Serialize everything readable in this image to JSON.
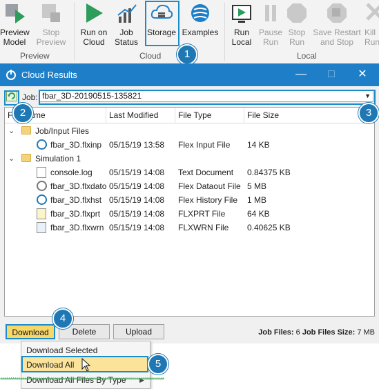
{
  "ribbon": {
    "groups": [
      {
        "label": "Preview"
      },
      {
        "label": "Cloud"
      },
      {
        "label": "Local"
      }
    ],
    "buttons": [
      {
        "line1": "Preview",
        "line2": "Model"
      },
      {
        "line1": "Stop",
        "line2": "Preview"
      },
      {
        "line1": "Run on",
        "line2": "Cloud"
      },
      {
        "line1": "Job",
        "line2": "Status"
      },
      {
        "line1": "Storage",
        "line2": ""
      },
      {
        "line1": "Examples",
        "line2": ""
      },
      {
        "line1": "Run",
        "line2": "Local"
      },
      {
        "line1": "Pause",
        "line2": "Run"
      },
      {
        "line1": "Stop",
        "line2": "Run"
      },
      {
        "line1": "Save Restart",
        "line2": "and Stop"
      },
      {
        "line1": "Kill",
        "line2": "Run"
      }
    ]
  },
  "markers": [
    "1",
    "2",
    "3",
    "4",
    "5"
  ],
  "dialog": {
    "title": "Cloud Results",
    "job_label": "Job:",
    "job_value": "fbar_3D-20190515-135821",
    "columns": [
      "File Name",
      "Last Modified",
      "File Type",
      "File Size"
    ],
    "rows": [
      {
        "name": "Job/Input Files",
        "modified": "",
        "type": "",
        "size": "",
        "icon": "folder-icon"
      },
      {
        "name": "fbar_3D.flxinp",
        "modified": "05/15/19 13:58",
        "type": "Flex Input File",
        "size": "14 KB",
        "icon": "flex-input-icon"
      },
      {
        "name": "Simulation 1",
        "modified": "",
        "type": "",
        "size": "",
        "icon": "folder-icon"
      },
      {
        "name": "console.log",
        "modified": "05/15/19 14:08",
        "type": "Text Document",
        "size": "0.84375 KB",
        "icon": "text-document-icon"
      },
      {
        "name": "fbar_3D.flxdato",
        "modified": "05/15/19 14:08",
        "type": "Flex Dataout File",
        "size": "5 MB",
        "icon": "flex-dataout-icon"
      },
      {
        "name": "fbar_3D.flxhst",
        "modified": "05/15/19 14:08",
        "type": "Flex History File",
        "size": "1 MB",
        "icon": "flex-history-icon"
      },
      {
        "name": "fbar_3D.flxprt",
        "modified": "05/15/19 14:08",
        "type": "FLXPRT File",
        "size": "64 KB",
        "icon": "flxprt-icon"
      },
      {
        "name": "fbar_3D.flxwrn",
        "modified": "05/15/19 14:08",
        "type": "FLXWRN File",
        "size": "0.40625 KB",
        "icon": "flxwrn-icon"
      }
    ],
    "buttons": {
      "download": "Download",
      "delete": "Delete",
      "upload": "Upload"
    },
    "stats": {
      "files_label": "Job Files:",
      "files_value": "6",
      "size_label": "Job Files Size:",
      "size_value": "7 MB"
    }
  },
  "menu": {
    "items": [
      {
        "label": "Download Selected"
      },
      {
        "label": "Download All"
      },
      {
        "label": "Download All Files By Type"
      }
    ]
  },
  "stars": "**********************************************************************************",
  "colors": {
    "accent": "#1e7fc8",
    "highlight": "#fbe39a",
    "marker": "#1f78b4"
  }
}
